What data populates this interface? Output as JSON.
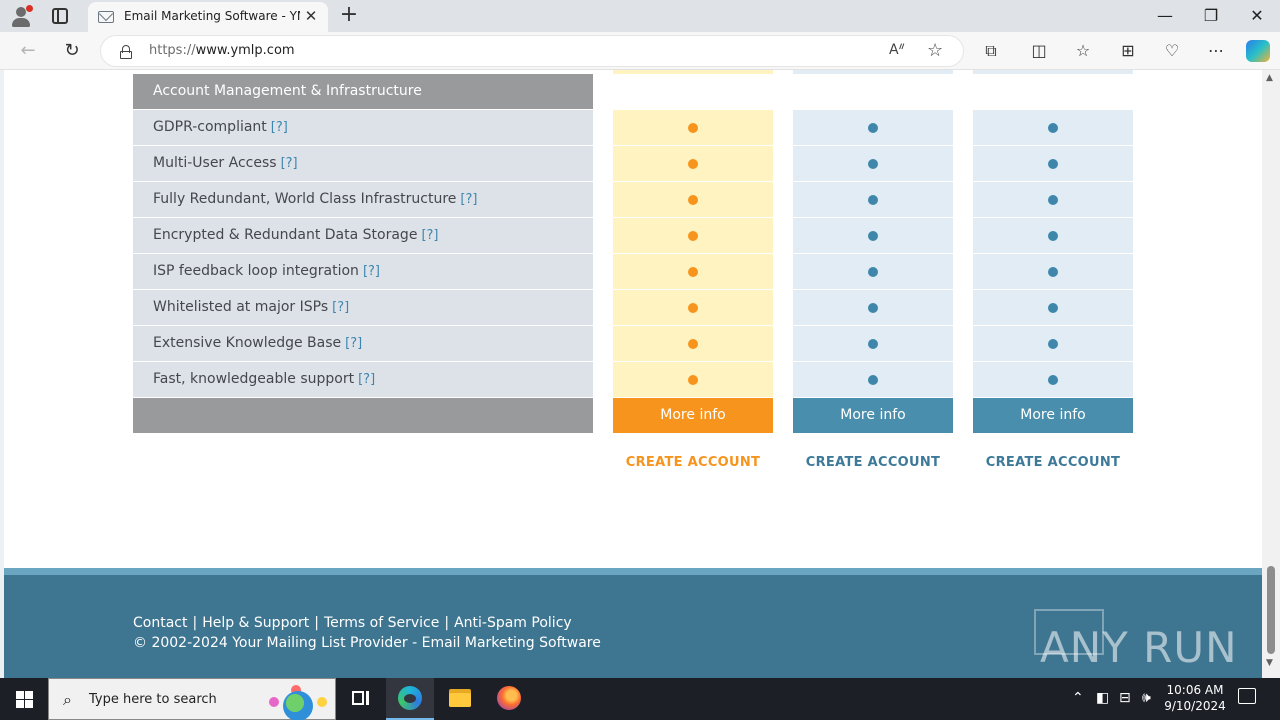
{
  "browser": {
    "tab_title": "Email Marketing Software - YMLP",
    "tab_close": "✕",
    "new_tab": "+",
    "url_protocol": "https://",
    "url_host": "www.ymlp.com",
    "window_controls": {
      "minimize": "—",
      "maximize": "❐",
      "close": "✕"
    },
    "icons": {
      "back": "←",
      "refresh": "↻",
      "read_aloud": "Aᐥ",
      "favorite": "☆",
      "extensions": "⧉",
      "split": "◫",
      "favorites": "☆",
      "collections": "⊞",
      "performance": "♡",
      "more": "⋯"
    }
  },
  "table": {
    "section_header": "Account Management & Infrastructure",
    "help_marker": "[?]",
    "features": [
      "GDPR-compliant",
      "Multi-User Access",
      "Fully Redundant, World Class Infrastructure",
      "Encrypted & Redundant Data Storage",
      "ISP feedback loop integration",
      "Whitelisted at major ISPs",
      "Extensive Knowledge Base",
      "Fast, knowledgeable support"
    ],
    "plans": [
      {
        "more_info": "More info",
        "create_account": "CREATE ACCOUNT",
        "accent": "#f7941d"
      },
      {
        "more_info": "More info",
        "create_account": "CREATE ACCOUNT",
        "accent": "#4a8ead"
      },
      {
        "more_info": "More info",
        "create_account": "CREATE ACCOUNT",
        "accent": "#4a8ead"
      }
    ]
  },
  "footer": {
    "links": [
      "Contact",
      "Help & Support",
      "Terms of Service",
      "Anti-Spam Policy"
    ],
    "separator": "|",
    "copyright": "© 2002-2024 Your Mailing List Provider - Email Marketing Software",
    "watermark": "ANY RUN"
  },
  "taskbar": {
    "search_placeholder": "Type here to search",
    "time": "10:06 AM",
    "date": "9/10/2024",
    "tray_icons": {
      "chevron": "⌃",
      "meet": "◧",
      "network": "⊟",
      "volume": "🕪"
    }
  }
}
